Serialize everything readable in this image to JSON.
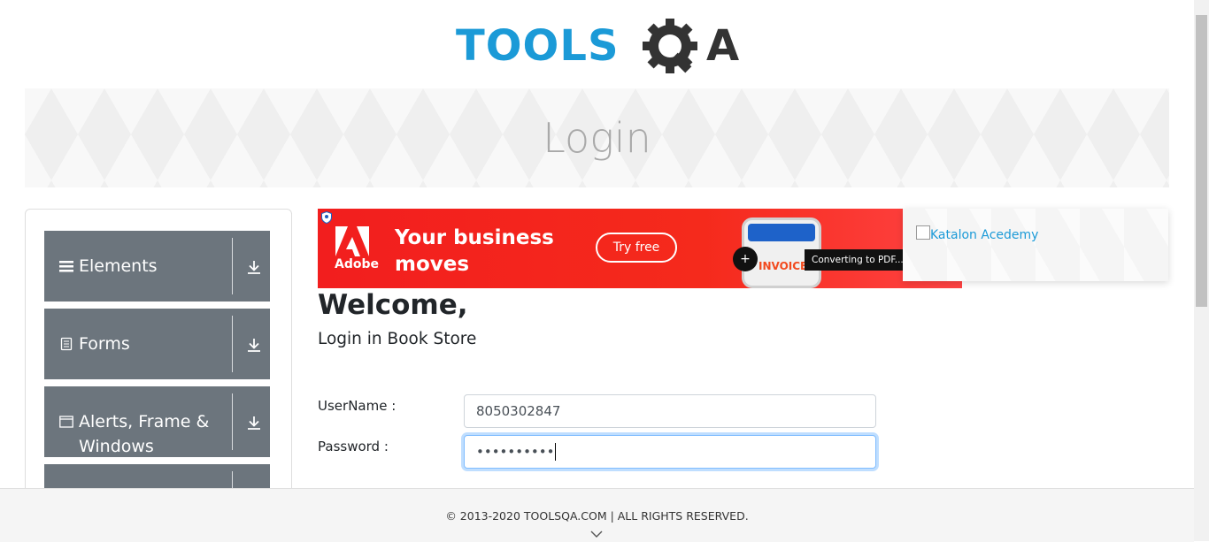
{
  "header": {
    "logo_part1": "TOOLS",
    "logo_part2": "A"
  },
  "banner": {
    "title": "Login"
  },
  "sidebar": {
    "groups": [
      {
        "label": "Elements",
        "icon": "hamburger-icon"
      },
      {
        "label": "Forms",
        "icon": "document-icon"
      },
      {
        "label": "Alerts, Frame &",
        "label2": "Windows",
        "icon": "window-icon"
      },
      {
        "label": "",
        "icon": "widget-icon"
      }
    ]
  },
  "ad": {
    "brand": "Adobe",
    "headline_line1": "Your business",
    "headline_line2": "moves",
    "cta": "Try free",
    "doc_label": "INVOICE",
    "plus": "+",
    "tooltip": "Converting to PDF..."
  },
  "side_ad": {
    "alt_text": "Katalon Acedemy"
  },
  "form": {
    "welcome": "Welcome,",
    "subtitle": "Login in Book Store",
    "username_label": "UserName :",
    "username_value": "8050302847",
    "password_label": "Password :",
    "password_value": "••••••••••"
  },
  "footer": {
    "copyright": "© 2013-2020 TOOLSQA.COM | ALL RIGHTS RESERVED."
  },
  "colors": {
    "brand_blue": "#1b9ad7",
    "sidebar_gray": "#6c757d",
    "ad_red": "#f21e1e",
    "focus_blue": "#80bdff"
  }
}
